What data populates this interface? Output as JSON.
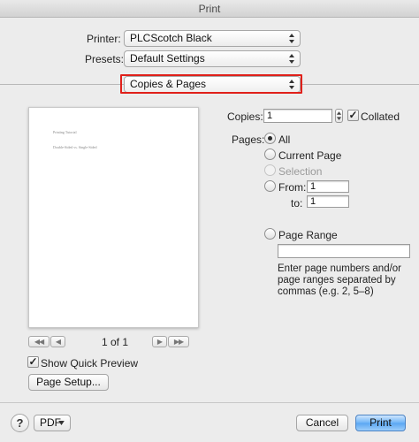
{
  "window": {
    "title": "Print"
  },
  "printer": {
    "label": "Printer:",
    "value": "PLCScotch Black"
  },
  "presets": {
    "label": "Presets:",
    "value": "Default Settings"
  },
  "section": {
    "value": "Copies & Pages"
  },
  "preview": {
    "line1": "Printing Tutorial",
    "line2": "Double-Sided vs. Single-Sided",
    "page_indicator": "1 of 1",
    "first_glyph": "◀◀",
    "prev_glyph": "◀",
    "next_glyph": "▶",
    "last_glyph": "▶▶"
  },
  "quick_preview": {
    "label": "Show Quick Preview",
    "checked": true
  },
  "page_setup": {
    "label": "Page Setup..."
  },
  "copies": {
    "label": "Copies:",
    "value": "1",
    "collated_label": "Collated",
    "collated": true
  },
  "pages": {
    "label": "Pages:",
    "all": "All",
    "current": "Current Page",
    "selection": "Selection",
    "from_label": "From:",
    "from_value": "1",
    "to_label": "to:",
    "to_value": "1",
    "range_label": "Page Range",
    "range_value": "",
    "hint": "Enter page numbers and/or page ranges separated by commas (e.g. 2, 5–8)"
  },
  "footer": {
    "help": "?",
    "pdf": "PDF",
    "cancel": "Cancel",
    "print": "Print"
  },
  "colors": {
    "highlight": "#e0201a",
    "primary_button": "#5aa6f2"
  },
  "icons": [
    "updown-arrows-icon",
    "checkmark-icon",
    "help-icon",
    "dropdown-arrow-icon"
  ]
}
